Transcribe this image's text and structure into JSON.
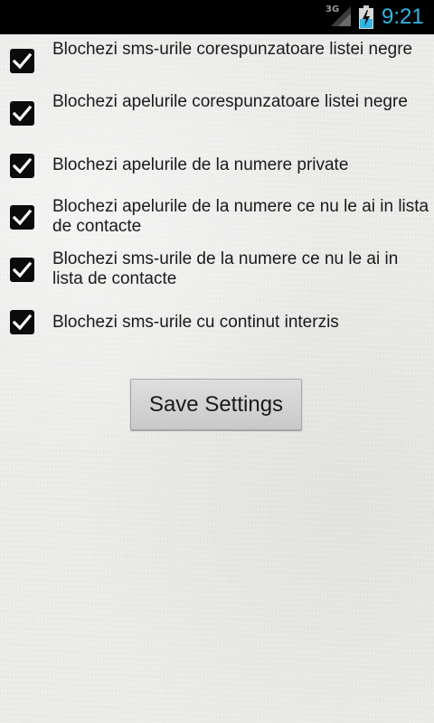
{
  "status_bar": {
    "network": "3G",
    "time": "9:21",
    "accent_color": "#33b5e5"
  },
  "options": [
    {
      "label": "Blochezi sms-urile corespunzatoare listei negre",
      "checked": true
    },
    {
      "label": "Blochezi apelurile corespunzatoare listei negre",
      "checked": true
    },
    {
      "label": "Blochezi apelurile de la numere private",
      "checked": true
    },
    {
      "label": "Blochezi apelurile de la numere ce nu le ai in lista de contacte",
      "checked": true
    },
    {
      "label": "Blochezi sms-urile de la numere ce nu le ai in lista de contacte",
      "checked": true
    },
    {
      "label": "Blochezi sms-urile cu continut interzis",
      "checked": true
    }
  ],
  "save_button": {
    "label": "Save Settings"
  },
  "icons": {
    "signal": "signal-icon",
    "battery": "battery-charging-icon",
    "checkbox": "checkmark-icon"
  }
}
